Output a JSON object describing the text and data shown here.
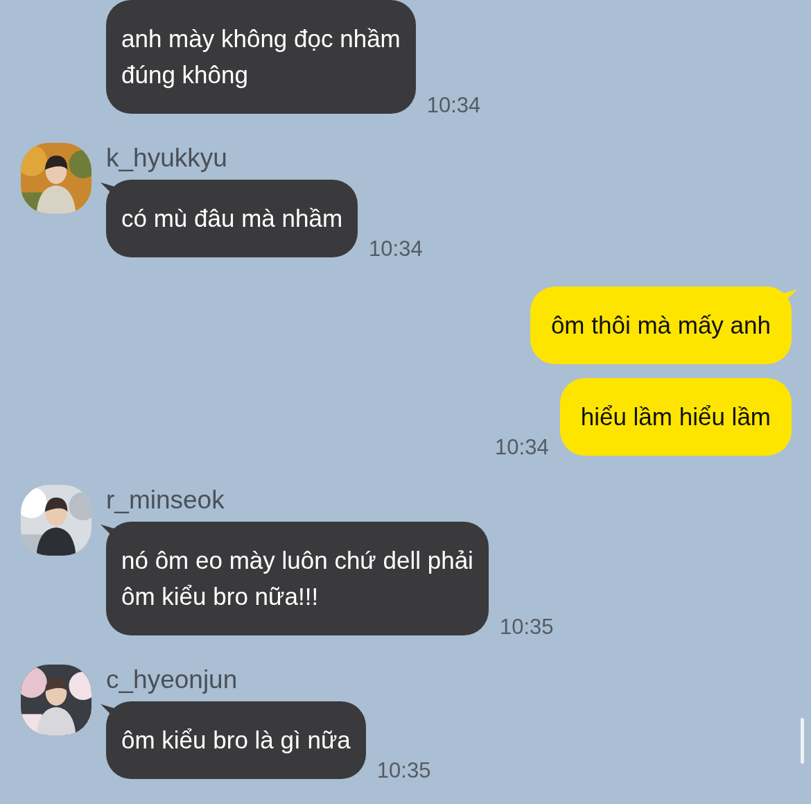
{
  "messages": [
    {
      "kind": "incoming",
      "text": "anh mày không đọc nhầm\nđúng không",
      "time": "10:34",
      "tail": false
    },
    {
      "kind": "incoming",
      "sender": "k_hyukkyu",
      "text": "có mù đâu mà nhầm",
      "time": "10:34",
      "tail": true
    },
    {
      "kind": "outgoing",
      "text": "ôm thôi mà mấy anh",
      "tail": true
    },
    {
      "kind": "outgoing",
      "text": "hiểu lầm hiểu lầm",
      "time": "10:34",
      "tail": false
    },
    {
      "kind": "incoming",
      "sender": "r_minseok",
      "text": "nó ôm eo mày luôn chứ dell phải\nôm kiểu bro nữa!!!",
      "time": "10:35",
      "tail": true
    },
    {
      "kind": "incoming",
      "sender": "c_hyeonjun",
      "text": "ôm kiểu bro là gì nữa",
      "time": "10:35",
      "tail": true
    }
  ]
}
